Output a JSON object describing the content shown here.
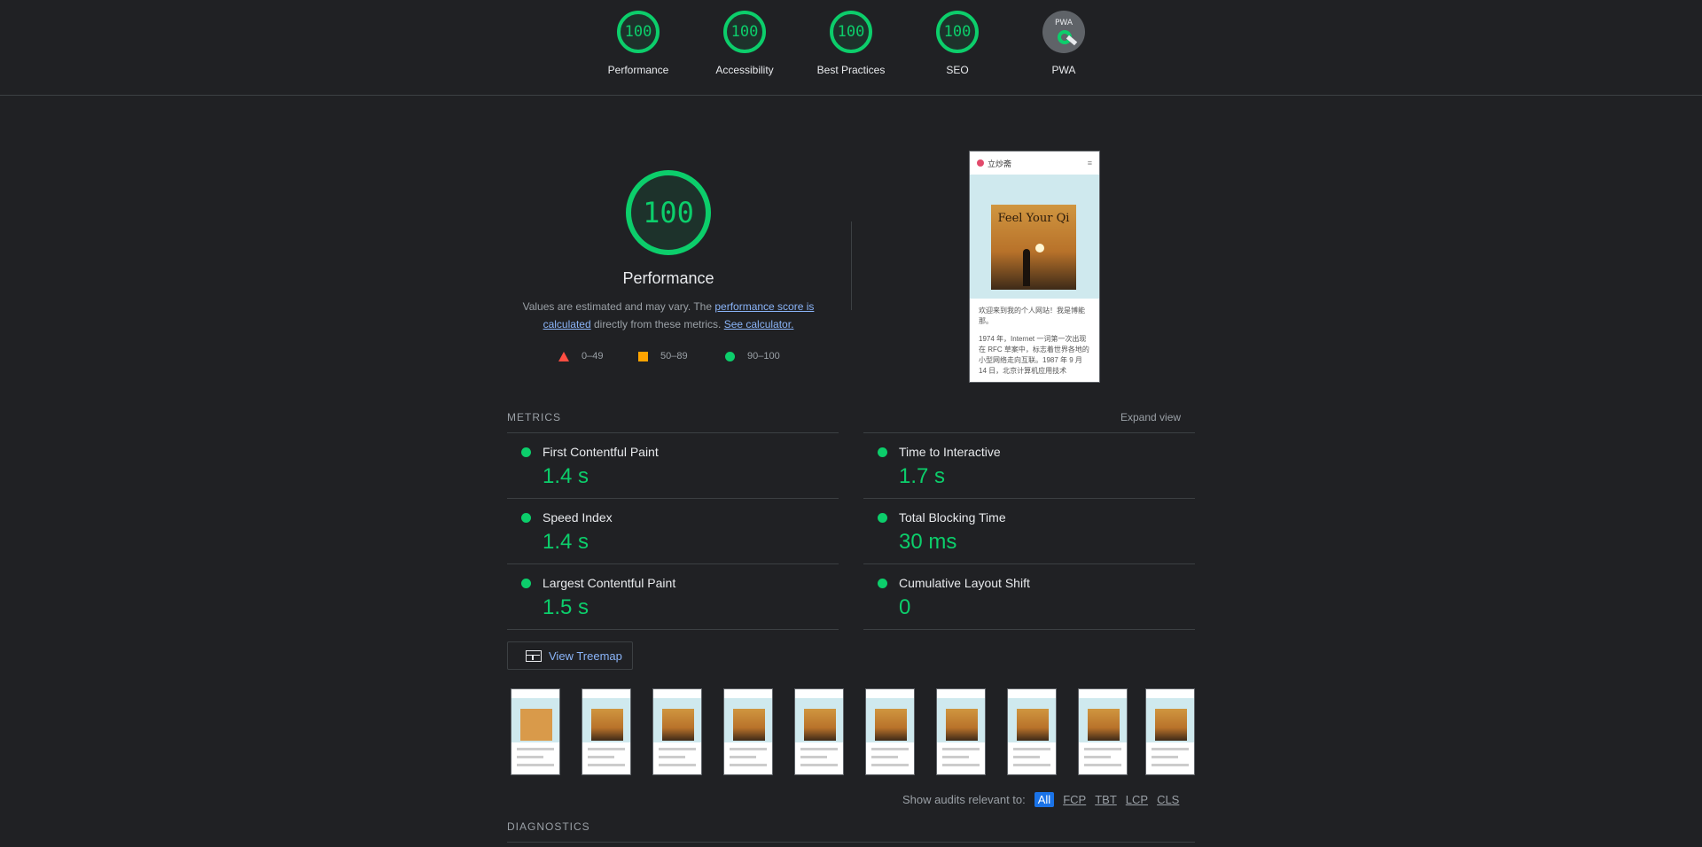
{
  "header": {
    "gauges": [
      {
        "label": "Performance",
        "score": "100"
      },
      {
        "label": "Accessibility",
        "score": "100"
      },
      {
        "label": "Best Practices",
        "score": "100"
      },
      {
        "label": "SEO",
        "score": "100"
      },
      {
        "label": "PWA",
        "badge_text": "PWA"
      }
    ]
  },
  "performance": {
    "score": "100",
    "title": "Performance",
    "desc_prefix": "Values are estimated and may vary. The ",
    "score_link": "performance score is calculated",
    "desc_middle": " directly from these metrics. ",
    "calculator_link": "See calculator.",
    "legend": {
      "fail": "0–49",
      "average": "50–89",
      "pass": "90–100"
    },
    "colors": {
      "pass": "#0cce6b",
      "average": "#ffa400",
      "fail": "#ff4e42"
    }
  },
  "screenshot": {
    "site_name": "立炒斋",
    "menu_icon": "menu-icon",
    "poster_title": "Feel Your Qi",
    "para1": "欢迎来到我的个人网站！我是博能那。",
    "para2": "1974 年，Internet 一词第一次出现在 RFC 草案中，标志着世界各地的小型网络走向互联。1987 年 9 月 14 日，北京计算机应用技术"
  },
  "metrics": {
    "section_label": "METRICS",
    "expand_label": "Expand view",
    "items": [
      {
        "name": "First Contentful Paint",
        "value": "1.4 s"
      },
      {
        "name": "Time to Interactive",
        "value": "1.7 s"
      },
      {
        "name": "Speed Index",
        "value": "1.4 s"
      },
      {
        "name": "Total Blocking Time",
        "value": "30 ms"
      },
      {
        "name": "Largest Contentful Paint",
        "value": "1.5 s"
      },
      {
        "name": "Cumulative Layout Shift",
        "value": "0"
      }
    ]
  },
  "treemap": {
    "label": "View Treemap"
  },
  "audits_filter": {
    "label": "Show audits relevant to:",
    "chips": [
      "All",
      "FCP",
      "TBT",
      "LCP",
      "CLS"
    ]
  },
  "diagnostics": {
    "label": "DIAGNOSTICS"
  }
}
